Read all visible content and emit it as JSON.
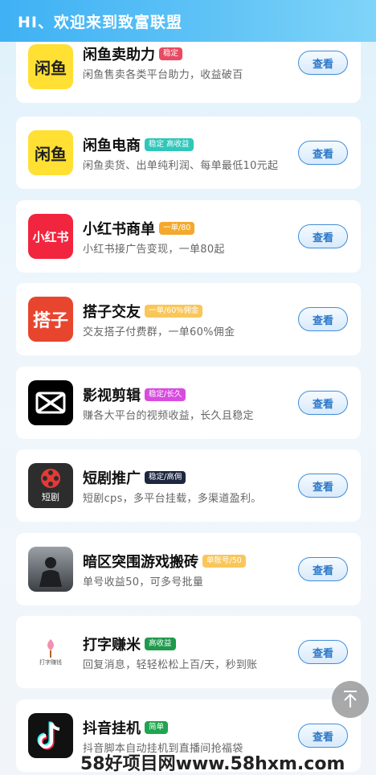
{
  "header": {
    "title": "HI、欢迎来到致富联盟"
  },
  "items": [
    {
      "title": "闲鱼卖助力",
      "tag": "稳定",
      "tag_color": "#e84a63",
      "desc": "闲鱼售卖各类平台助力，收益破百",
      "button": "查看",
      "icon": "xianyu-icon",
      "icon_text": "闲鱼"
    },
    {
      "title": "闲鱼电商",
      "tag": "稳定 高收益",
      "tag_color": "#2fc7b9",
      "desc": "闲鱼卖货、出单纯利润、每单最低10元起",
      "button": "查看",
      "icon": "xianyu-icon",
      "icon_text": "闲鱼"
    },
    {
      "title": "小红书商单",
      "tag": "一单/80",
      "tag_color": "#f4a82c",
      "desc": "小红书接广告变现，一单80起",
      "button": "查看",
      "icon": "xiaohongshu-icon",
      "icon_text": "小红书"
    },
    {
      "title": "搭子交友",
      "tag": "一单/60%佣金",
      "tag_color": "#f9c65a",
      "desc": "交友搭子付费群，一单60%佣金",
      "button": "查看",
      "icon": "dazi-icon",
      "icon_text": "搭子"
    },
    {
      "title": "影视剪辑",
      "tag": "稳定/长久",
      "tag_color": "#d94be0",
      "desc": "赚各大平台的视频收益，长久且稳定",
      "button": "查看",
      "icon": "capcut-icon",
      "icon_text": ""
    },
    {
      "title": "短剧推广",
      "tag": "稳定/高佣",
      "tag_color": "#1d2740",
      "desc": "短剧cps，多平台挂载，多渠道盈利。",
      "button": "查看",
      "icon": "film-reel-icon",
      "icon_text": "短剧"
    },
    {
      "title": "暗区突围游戏搬砖",
      "tag": "单账号/50",
      "tag_color": "#f9c65a",
      "desc": "单号收益50，可多号批量",
      "button": "查看",
      "icon": "game-soldier-icon",
      "icon_text": ""
    },
    {
      "title": "打字赚米",
      "tag": "高收益",
      "tag_color": "#1f9a4c",
      "desc": "回复消息，轻轻松松上百/天，秒到账",
      "button": "查看",
      "icon": "typing-logo-icon",
      "icon_text": "打字赚钱"
    },
    {
      "title": "抖音挂机",
      "tag": "简单",
      "tag_color": "#1fa54f",
      "desc": "抖音脚本自动挂机到直播间抢福袋",
      "button": "查看",
      "icon": "douyin-icon",
      "icon_text": ""
    }
  ],
  "watermark": "58好项目网www.58hxm.com"
}
